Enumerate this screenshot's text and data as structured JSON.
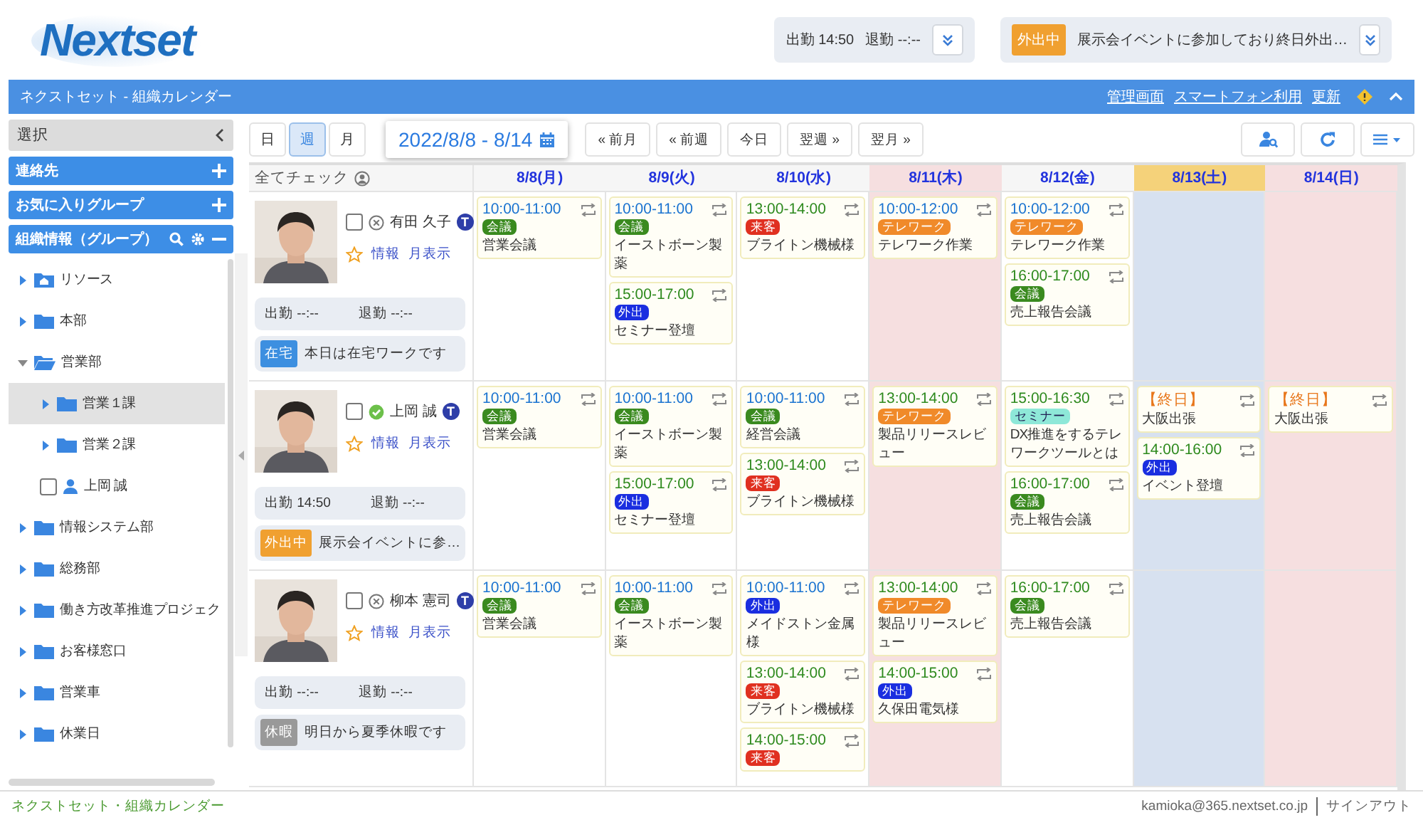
{
  "header": {
    "logo": "Nextset",
    "attendance": {
      "clock_in": "出勤 14:50",
      "clock_out": "退勤 --:--"
    },
    "status": {
      "badge": "外出中",
      "color": "#f0a030",
      "message": "展示会イベントに参加しており終日外出…"
    }
  },
  "title_bar": {
    "title": "ネクストセット - 組織カレンダー",
    "links": [
      "管理画面",
      "スマートフォン利用",
      "更新"
    ]
  },
  "sidebar": {
    "header": "選択",
    "panels": [
      {
        "label": "連絡先",
        "kind": "add"
      },
      {
        "label": "お気に入りグループ",
        "kind": "add"
      },
      {
        "label": "組織情報（グループ）",
        "kind": "tools"
      }
    ],
    "tree": [
      {
        "label": "リソース",
        "kind": "resource",
        "expanded": false,
        "selected": false
      },
      {
        "label": "本部",
        "kind": "folder",
        "expanded": false,
        "selected": false
      },
      {
        "label": "営業部",
        "kind": "folder",
        "expanded": true,
        "selected": false,
        "children": [
          {
            "label": "営業１課",
            "kind": "folder",
            "expanded": false,
            "selected": true
          },
          {
            "label": "営業２課",
            "kind": "folder",
            "expanded": false,
            "selected": false
          },
          {
            "label": "上岡 誠",
            "kind": "person",
            "checked": false,
            "selected": false
          }
        ]
      },
      {
        "label": "情報システム部",
        "kind": "folder",
        "expanded": false,
        "selected": false
      },
      {
        "label": "総務部",
        "kind": "folder",
        "expanded": false,
        "selected": false
      },
      {
        "label": "働き方改革推進プロジェク",
        "kind": "folder",
        "expanded": false,
        "selected": false
      },
      {
        "label": "お客様窓口",
        "kind": "folder",
        "expanded": false,
        "selected": false
      },
      {
        "label": "営業車",
        "kind": "folder",
        "expanded": false,
        "selected": false
      },
      {
        "label": "休業日",
        "kind": "folder",
        "expanded": false,
        "selected": false
      }
    ]
  },
  "toolbar": {
    "view_tabs": [
      {
        "label": "日",
        "selected": false
      },
      {
        "label": "週",
        "selected": true
      },
      {
        "label": "月",
        "selected": false
      }
    ],
    "date_range": "2022/8/8 - 8/14",
    "nav_buttons": [
      "« 前月",
      "« 前週",
      "今日",
      "翌週 »",
      "翌月 »"
    ]
  },
  "calendar": {
    "check_all": "全てチェック",
    "days": [
      {
        "label": "8/8(月)",
        "kind": "weekday"
      },
      {
        "label": "8/9(火)",
        "kind": "weekday"
      },
      {
        "label": "8/10(水)",
        "kind": "weekday"
      },
      {
        "label": "8/11(木)",
        "kind": "holiday"
      },
      {
        "label": "8/12(金)",
        "kind": "weekday"
      },
      {
        "label": "8/13(土)",
        "kind": "saturday"
      },
      {
        "label": "8/14(日)",
        "kind": "sunday"
      }
    ],
    "rows": [
      {
        "person": {
          "name": "有田 久子",
          "checked": false,
          "kind": "absent",
          "badge": "T",
          "links": [
            "情報",
            "月表示"
          ],
          "clock_in": "出勤 --:--",
          "clock_out": "退勤 --:--",
          "status": {
            "badge": "在宅",
            "color": "#3d8fe0",
            "message": "本日は在宅ワークです"
          }
        },
        "cells": [
          [
            {
              "time": "10:00-11:00",
              "color": "#1a73d0",
              "tag": {
                "label": "会議",
                "color": "#3a8a1f"
              },
              "text": "営業会議"
            }
          ],
          [
            {
              "time": "10:00-11:00",
              "color": "#1a73d0",
              "tag": {
                "label": "会議",
                "color": "#3a8a1f"
              },
              "text": "イーストボーン製薬"
            },
            {
              "time": "15:00-17:00",
              "color": "#2e8a1e",
              "tag": {
                "label": "外出",
                "color": "#1a2ee0"
              },
              "text": "セミナー登壇"
            }
          ],
          [
            {
              "time": "13:00-14:00",
              "color": "#2e8a1e",
              "tag": {
                "label": "来客",
                "color": "#e03020"
              },
              "text": "ブライトン機械様"
            }
          ],
          [
            {
              "time": "10:00-12:00",
              "color": "#1a73d0",
              "tag": {
                "label": "テレワーク",
                "color": "#f08a2a"
              },
              "text": "テレワーク作業"
            }
          ],
          [
            {
              "time": "10:00-12:00",
              "color": "#1a73d0",
              "tag": {
                "label": "テレワーク",
                "color": "#f08a2a"
              },
              "text": "テレワーク作業"
            },
            {
              "time": "16:00-17:00",
              "color": "#2e8a1e",
              "tag": {
                "label": "会議",
                "color": "#3a8a1f"
              },
              "text": "売上報告会議"
            }
          ],
          [],
          []
        ]
      },
      {
        "person": {
          "name": "上岡 誠",
          "checked": false,
          "kind": "present",
          "badge": "T",
          "links": [
            "情報",
            "月表示"
          ],
          "clock_in": "出勤 14:50",
          "clock_out": "退勤 --:--",
          "status": {
            "badge": "外出中",
            "color": "#f0a030",
            "message": "展示会イベントに参…"
          }
        },
        "cells": [
          [
            {
              "time": "10:00-11:00",
              "color": "#1a73d0",
              "tag": {
                "label": "会議",
                "color": "#3a8a1f"
              },
              "text": "営業会議"
            }
          ],
          [
            {
              "time": "10:00-11:00",
              "color": "#1a73d0",
              "tag": {
                "label": "会議",
                "color": "#3a8a1f"
              },
              "text": "イーストボーン製薬"
            },
            {
              "time": "15:00-17:00",
              "color": "#2e8a1e",
              "tag": {
                "label": "外出",
                "color": "#1a2ee0"
              },
              "text": "セミナー登壇"
            }
          ],
          [
            {
              "time": "10:00-11:00",
              "color": "#1a73d0",
              "tag": {
                "label": "会議",
                "color": "#3a8a1f"
              },
              "text": "経営会議"
            },
            {
              "time": "13:00-14:00",
              "color": "#2e8a1e",
              "tag": {
                "label": "来客",
                "color": "#e03020"
              },
              "text": "ブライトン機械様"
            }
          ],
          [
            {
              "time": "13:00-14:00",
              "color": "#2e8a1e",
              "tag": {
                "label": "テレワーク",
                "color": "#f08a2a"
              },
              "text": "製品リリースレビュー"
            }
          ],
          [
            {
              "time": "15:00-16:30",
              "color": "#2e8a1e",
              "tag": {
                "label": "セミナー",
                "color": "#8ee8d8"
              },
              "text": "DX推進をするテレワークツールとは"
            },
            {
              "time": "16:00-17:00",
              "color": "#2e8a1e",
              "tag": {
                "label": "会議",
                "color": "#3a8a1f"
              },
              "text": "売上報告会議"
            }
          ],
          [
            {
              "time": "【終日】",
              "color": "#e8771c",
              "text": "大阪出張"
            },
            {
              "time": "14:00-16:00",
              "color": "#2e8a1e",
              "tag": {
                "label": "外出",
                "color": "#1a2ee0"
              },
              "text": "イベント登壇"
            }
          ],
          [
            {
              "time": "【終日】",
              "color": "#e8771c",
              "text": "大阪出張"
            }
          ]
        ]
      },
      {
        "person": {
          "name": "柳本 憲司",
          "checked": false,
          "kind": "absent",
          "badge": "T",
          "links": [
            "情報",
            "月表示"
          ],
          "clock_in": "出勤 --:--",
          "clock_out": "退勤 --:--",
          "status": {
            "badge": "休暇",
            "color": "#999999",
            "message": "明日から夏季休暇です"
          }
        },
        "cells": [
          [
            {
              "time": "10:00-11:00",
              "color": "#1a73d0",
              "tag": {
                "label": "会議",
                "color": "#3a8a1f"
              },
              "text": "営業会議"
            }
          ],
          [
            {
              "time": "10:00-11:00",
              "color": "#1a73d0",
              "tag": {
                "label": "会議",
                "color": "#3a8a1f"
              },
              "text": "イーストボーン製薬"
            }
          ],
          [
            {
              "time": "10:00-11:00",
              "color": "#1a73d0",
              "tag": {
                "label": "外出",
                "color": "#1a2ee0"
              },
              "text": "メイドストン金属様"
            },
            {
              "time": "13:00-14:00",
              "color": "#2e8a1e",
              "tag": {
                "label": "来客",
                "color": "#e03020"
              },
              "text": "ブライトン機械様"
            },
            {
              "time": "14:00-15:00",
              "color": "#2e8a1e",
              "tag": {
                "label": "来客",
                "color": "#e03020"
              }
            }
          ],
          [
            {
              "time": "13:00-14:00",
              "color": "#2e8a1e",
              "tag": {
                "label": "テレワーク",
                "color": "#f08a2a"
              },
              "text": "製品リリースレビュー"
            },
            {
              "time": "14:00-15:00",
              "color": "#2e8a1e",
              "tag": {
                "label": "外出",
                "color": "#1a2ee0"
              },
              "text": "久保田電気様"
            }
          ],
          [
            {
              "time": "16:00-17:00",
              "color": "#2e8a1e",
              "tag": {
                "label": "会議",
                "color": "#3a8a1f"
              },
              "text": "売上報告会議"
            }
          ],
          [],
          []
        ]
      }
    ]
  },
  "footer": {
    "app_name": "ネクストセット・組織カレンダー",
    "account": "kamioka@365.nextset.co.jp",
    "sign_out": "サインアウト"
  }
}
